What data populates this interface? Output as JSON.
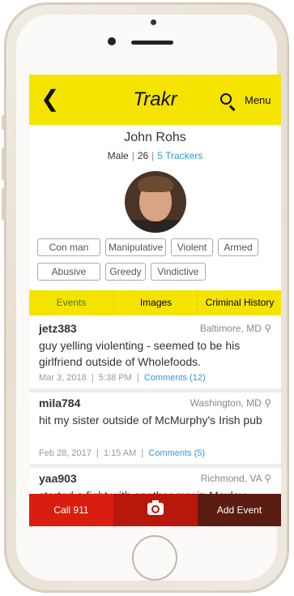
{
  "header": {
    "title": "Trakr",
    "menu_label": "Menu"
  },
  "profile": {
    "name": "John Rohs",
    "gender": "Male",
    "age": "26",
    "trackers_label": "5 Trackers"
  },
  "tags": [
    "Con man",
    "Manipulative",
    "Violent",
    "Armed",
    "Abusive",
    "Greedy",
    "Vindictive"
  ],
  "tabs": [
    "Events",
    "Images",
    "Criminal History"
  ],
  "events": [
    {
      "user": "jetz383",
      "location": "Baltimore, MD",
      "description": "guy yelling violenting - seemed to be his girlfriend outside of Wholefoods.",
      "date": "Mar 3, 2018",
      "time": "5:38 PM",
      "comments": "Comments (12)"
    },
    {
      "user": "mila784",
      "location": "Washington, MD",
      "description": "hit my sister outside of McMurphy's Irish pub",
      "date": "Feb 28, 2017",
      "time": "1:15 AM",
      "comments": "Comments (5)"
    },
    {
      "user": "yaa903",
      "location": "Richmond, VA",
      "description": "started a fight with another guy in Moxley"
    }
  ],
  "bottom": {
    "call_label": "Call 911",
    "add_label": "Add Event"
  },
  "colors": {
    "accent": "#f5e300",
    "call": "#d91e0f",
    "camera": "#b8170b",
    "add": "#5a1c12",
    "link": "#2e9bd6"
  }
}
